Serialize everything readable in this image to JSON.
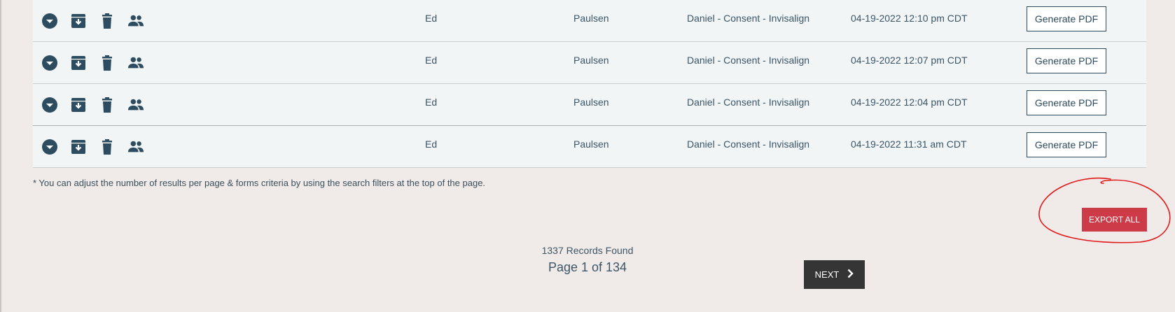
{
  "table": {
    "rows": [
      {
        "first": "Ed",
        "last": "Paulsen",
        "form": "Daniel - Consent - Invisalign",
        "date": "04-19-2022 12:10 pm CDT",
        "action_label": "Generate PDF"
      },
      {
        "first": "Ed",
        "last": "Paulsen",
        "form": "Daniel - Consent - Invisalign",
        "date": "04-19-2022 12:07 pm CDT",
        "action_label": "Generate PDF"
      },
      {
        "first": "Ed",
        "last": "Paulsen",
        "form": "Daniel - Consent - Invisalign",
        "date": "04-19-2022 12:04 pm CDT",
        "action_label": "Generate PDF"
      },
      {
        "first": "Ed",
        "last": "Paulsen",
        "form": "Daniel - Consent - Invisalign",
        "date": "04-19-2022 11:31 am CDT",
        "action_label": "Generate PDF"
      }
    ],
    "row_icons": [
      "chevron-down-circle-icon",
      "archive-download-icon",
      "trash-icon",
      "people-icon"
    ]
  },
  "note": "* You can adjust the number of results per page & forms criteria by using the search filters at the top of the page.",
  "export_label": "EXPORT ALL",
  "pagination": {
    "records": "1337 Records Found",
    "page": "Page 1 of 134",
    "next_label": "NEXT"
  },
  "colors": {
    "icon": "#2d4c5f",
    "export": "#cc3b47",
    "next": "#363535",
    "annotation": "#e01b1b"
  }
}
